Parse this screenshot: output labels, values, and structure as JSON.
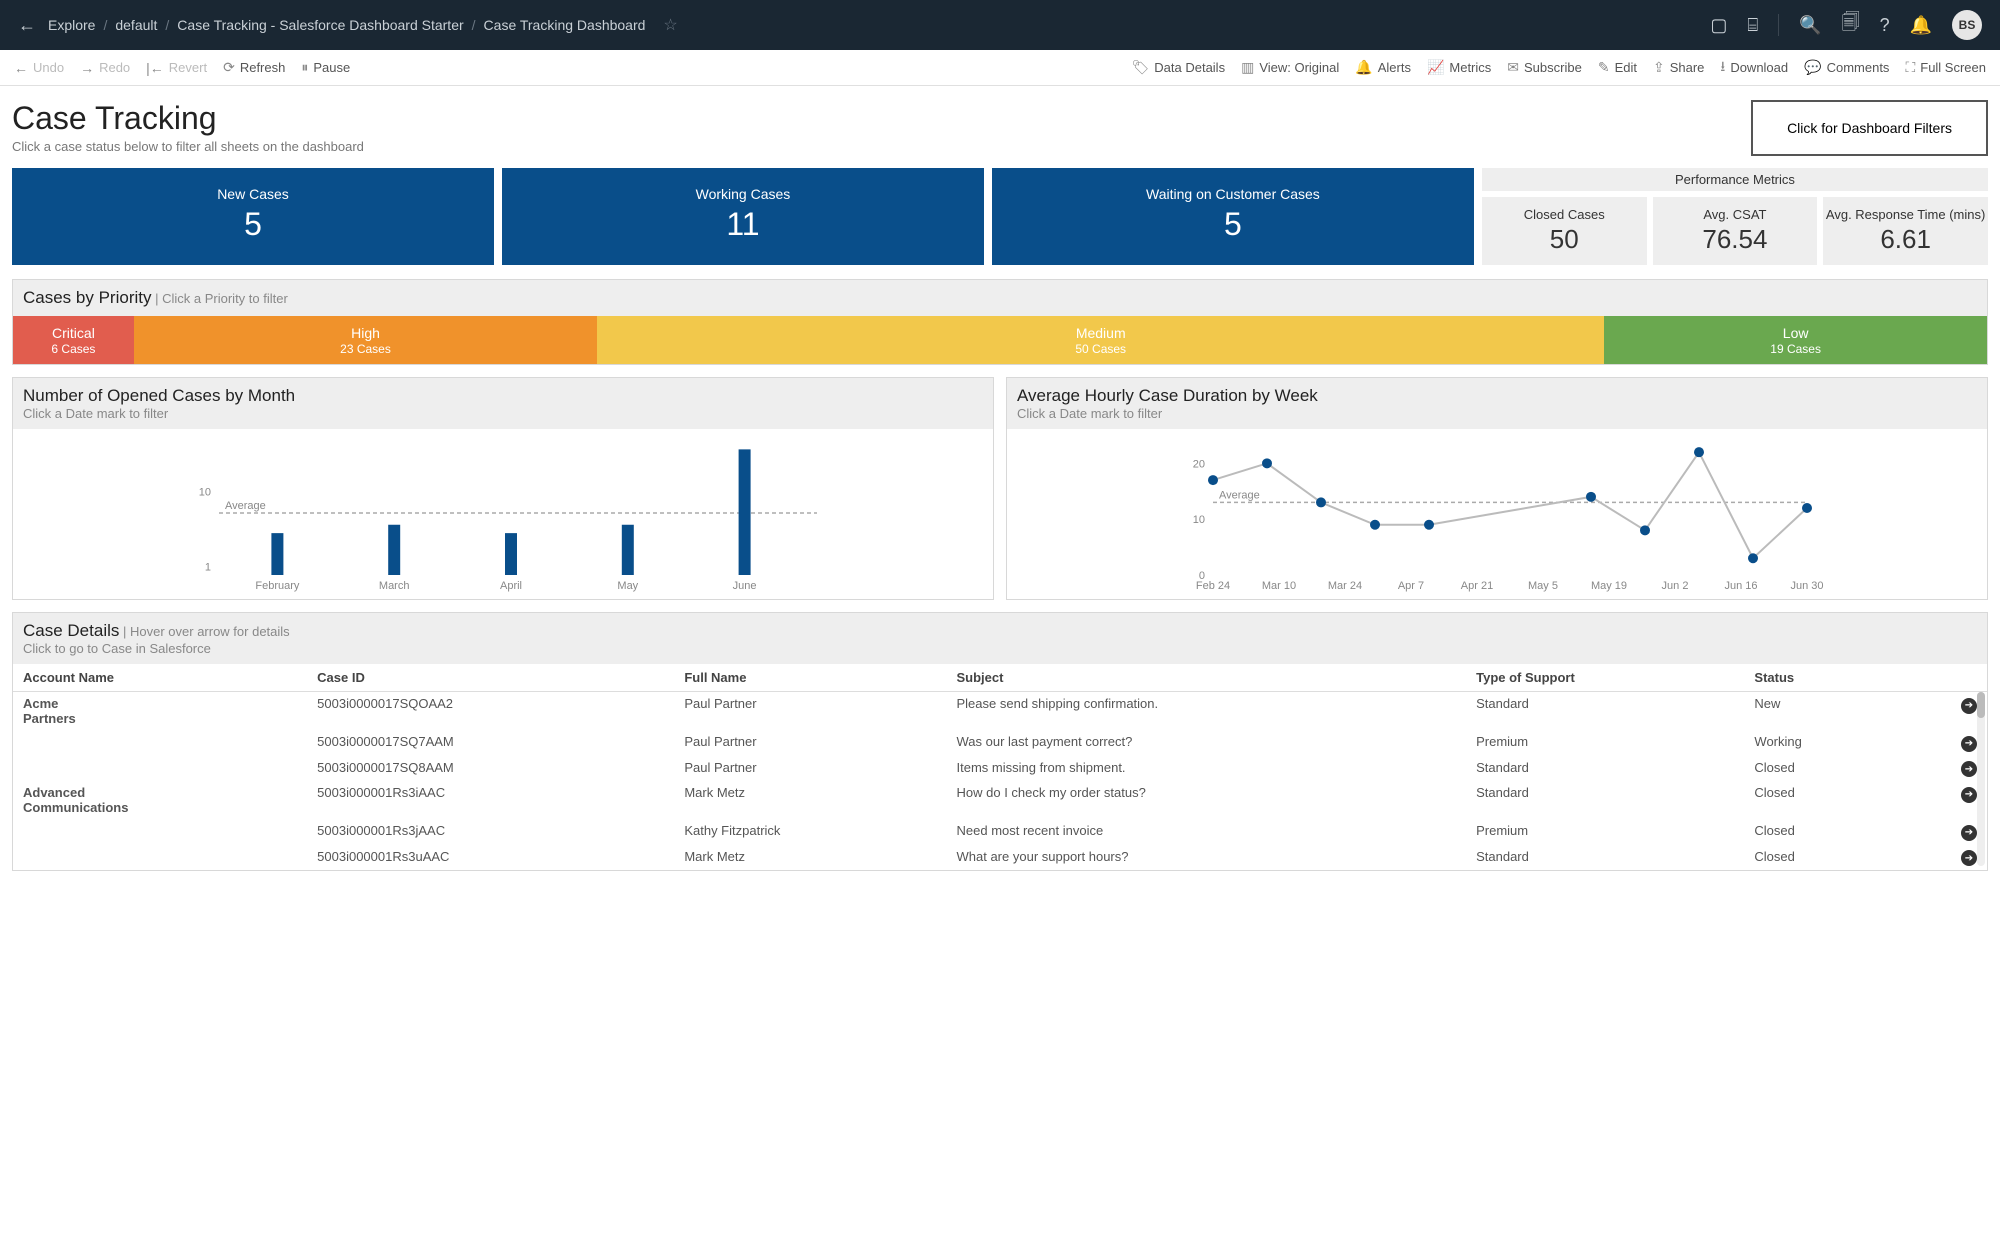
{
  "topbar": {
    "crumbs": [
      "Explore",
      "default",
      "Case Tracking - Salesforce Dashboard Starter",
      "Case Tracking Dashboard"
    ],
    "avatar": "BS"
  },
  "toolbar": {
    "undo": "Undo",
    "redo": "Redo",
    "revert": "Revert",
    "refresh": "Refresh",
    "pause": "Pause",
    "datadetails": "Data Details",
    "view": "View: Original",
    "alerts": "Alerts",
    "metrics": "Metrics",
    "subscribe": "Subscribe",
    "edit": "Edit",
    "share": "Share",
    "download": "Download",
    "comments": "Comments",
    "fullscreen": "Full Screen"
  },
  "header": {
    "title": "Case Tracking",
    "subtitle": "Click a case status below to filter all sheets on the dashboard",
    "filter_btn": "Click for Dashboard Filters"
  },
  "kpi_blue": [
    {
      "label": "New Cases",
      "value": "5"
    },
    {
      "label": "Working Cases",
      "value": "11"
    },
    {
      "label": "Waiting on Customer Cases",
      "value": "5"
    }
  ],
  "perf": {
    "title": "Performance Metrics",
    "cards": [
      {
        "label": "Closed Cases",
        "value": "50"
      },
      {
        "label": "Avg. CSAT",
        "value": "76.54"
      },
      {
        "label": "Avg. Response Time (mins)",
        "value": "6.61"
      }
    ]
  },
  "priority": {
    "title": "Cases by Priority",
    "hint": "Click a Priority to filter",
    "items": [
      {
        "label": "Critical",
        "count": "6 Cases",
        "color": "#e15d4e",
        "weight": 6
      },
      {
        "label": "High",
        "count": "23 Cases",
        "color": "#f0922b",
        "weight": 23
      },
      {
        "label": "Medium",
        "count": "50 Cases",
        "color": "#f2c84b",
        "weight": 50
      },
      {
        "label": "Low",
        "count": "19 Cases",
        "color": "#6aa84f",
        "weight": 19
      }
    ]
  },
  "chart_data": [
    {
      "type": "bar",
      "title": "Number of Opened Cases by Month",
      "hint": "Click a Date mark to filter",
      "categories": [
        "February",
        "March",
        "April",
        "May",
        "June"
      ],
      "values": [
        5,
        6,
        5,
        6,
        15
      ],
      "ylabel_ticks": [
        1,
        10
      ],
      "average_label": "Average",
      "average_value": 7.4
    },
    {
      "type": "line",
      "title": "Average Hourly Case Duration by Week",
      "hint": "Click a Date mark to filter",
      "x": [
        "Feb 24",
        "Mar 10",
        "Mar 24",
        "Apr 7",
        "Apr 21",
        "May 5",
        "May 19",
        "Jun 2",
        "Jun 16",
        "Jun 30"
      ],
      "y": [
        17,
        20,
        13,
        9,
        9,
        null,
        null,
        14,
        8,
        22,
        3,
        12
      ],
      "yticks": [
        0,
        10,
        20
      ],
      "average_label": "Average",
      "average_value": 13
    }
  ],
  "details": {
    "title": "Case Details",
    "hint1": "Hover over arrow for details",
    "hint2": "Click to go to Case in Salesforce",
    "columns": [
      "Account Name",
      "Case ID",
      "Full Name",
      "Subject",
      "Type of Support",
      "Status"
    ],
    "rows": [
      {
        "acct": "Acme Partners",
        "id": "5003i0000017SQOAA2",
        "name": "Paul Partner",
        "subj": "Please send shipping confirmation.",
        "type": "Standard",
        "status": "New"
      },
      {
        "acct": "",
        "id": "5003i0000017SQ7AAM",
        "name": "Paul Partner",
        "subj": "Was our last payment correct?",
        "type": "Premium",
        "status": "Working"
      },
      {
        "acct": "",
        "id": "5003i0000017SQ8AAM",
        "name": "Paul Partner",
        "subj": "Items missing from shipment.",
        "type": "Standard",
        "status": "Closed"
      },
      {
        "acct": "Advanced Communications",
        "id": "5003i000001Rs3iAAC",
        "name": "Mark Metz",
        "subj": "How do I check my order status?",
        "type": "Standard",
        "status": "Closed"
      },
      {
        "acct": "",
        "id": "5003i000001Rs3jAAC",
        "name": "Kathy Fitzpatrick",
        "subj": "Need most recent invoice",
        "type": "Premium",
        "status": "Closed"
      },
      {
        "acct": "",
        "id": "5003i000001Rs3uAAC",
        "name": "Mark Metz",
        "subj": "What are your support hours?",
        "type": "Standard",
        "status": "Closed"
      }
    ]
  }
}
